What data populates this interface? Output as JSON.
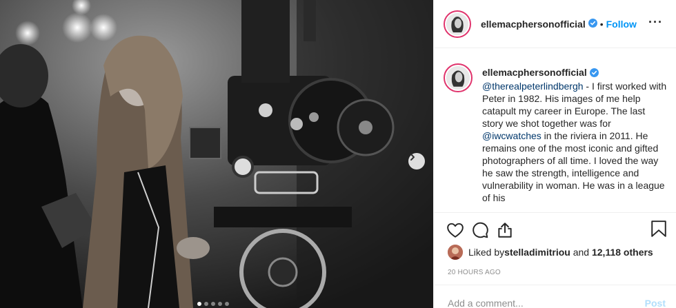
{
  "post": {
    "username": "ellemacphersonofficial",
    "bullet": "•",
    "follow_label": "Follow",
    "more_label": "···",
    "slide_count": 5,
    "active_slide": 1
  },
  "caption": {
    "username": "ellemacphersonofficial",
    "mention1": "@therealpeterlindbergh",
    "text1": " - I first worked with Peter in 1982. His images of me help catapult my career in Europe. The last story we shot together was for ",
    "mention2": "@iwcwatches",
    "text2": " in the riviera in 2011. He remains one of the most iconic and gifted photographers of all time. I loved the way he saw the strength, intelligence and vulnerability in woman. He was in a league of his"
  },
  "likes": {
    "prefix": "Liked by ",
    "user": "stelladimitriou",
    "middle": " and ",
    "count": "12,118 others"
  },
  "timestamp": "20 HOURS AGO",
  "comment": {
    "placeholder": "Add a comment...",
    "post_label": "Post"
  },
  "icons": {
    "like": "heart-icon",
    "comment": "comment-icon",
    "share": "share-icon",
    "save": "bookmark-icon",
    "verified": "verified-badge-icon",
    "next": "chevron-right-icon"
  },
  "colors": {
    "link": "#0095f6",
    "mention": "#00376b",
    "muted": "#8e8e8e",
    "story_ring": "#e0336c"
  }
}
